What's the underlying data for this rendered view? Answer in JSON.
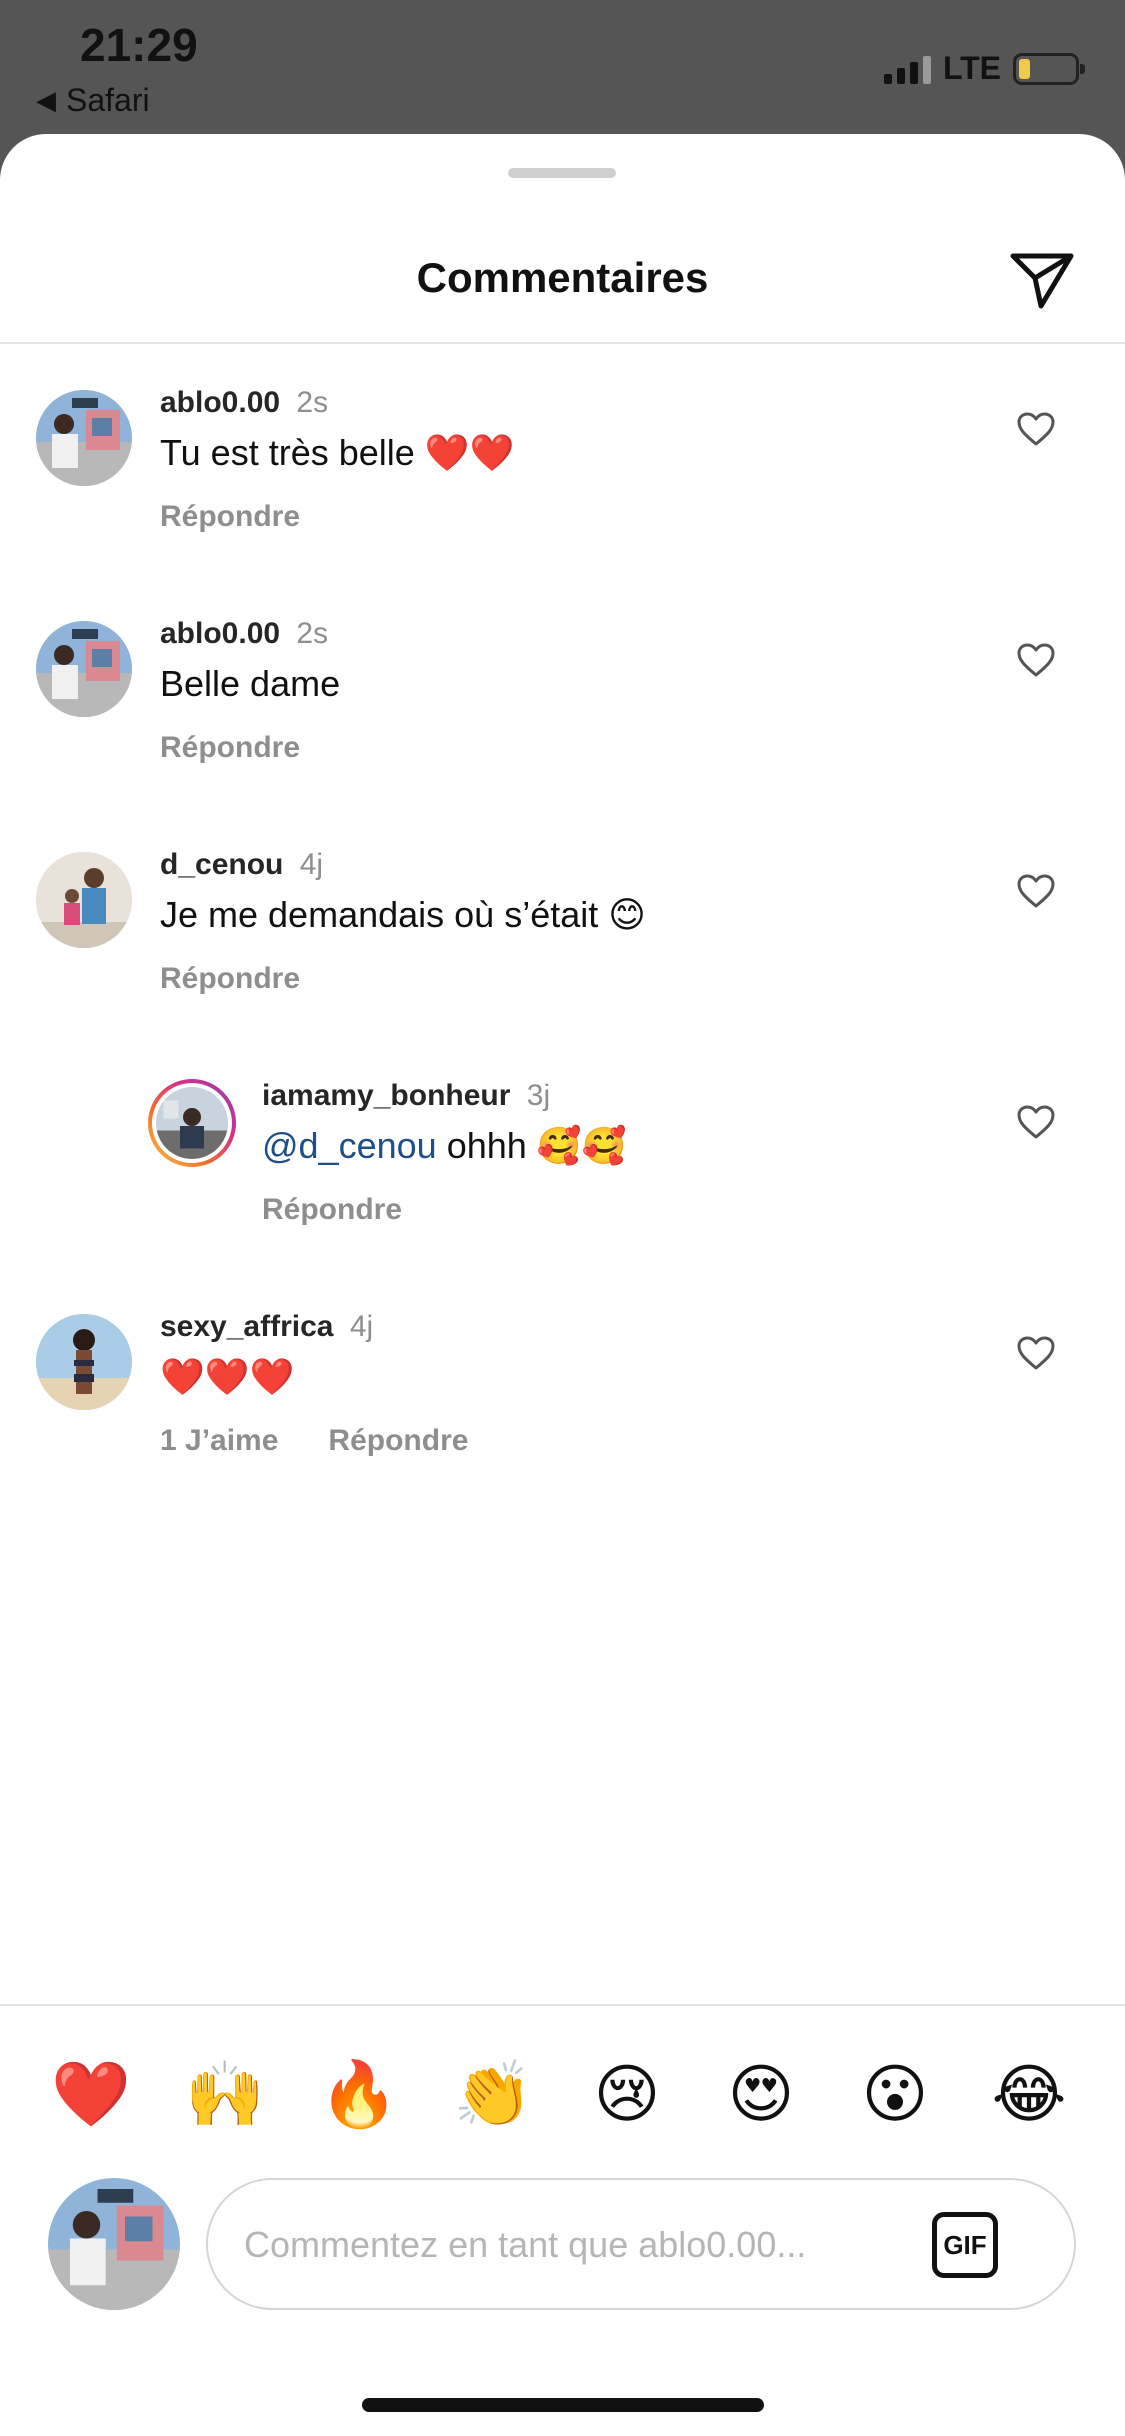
{
  "status_bar": {
    "time": "21:29",
    "back_app": "Safari",
    "back_arrow": "◀",
    "network": "LTE",
    "signal_bars_active": 3,
    "battery_level": 0.2,
    "battery_color": "#f2c94c"
  },
  "sheet": {
    "title": "Commentaires",
    "send_icon": "paper-plane-icon"
  },
  "comments": [
    {
      "username": "ablo0.00",
      "time": "2s",
      "text": "Tu est très belle ❤️❤️",
      "reply_label": "Répondre",
      "likes_label": "",
      "reply_to": ""
    },
    {
      "username": "ablo0.00",
      "time": "2s",
      "text": "Belle dame",
      "reply_label": "Répondre",
      "likes_label": "",
      "reply_to": ""
    },
    {
      "username": "d_cenou",
      "time": "4j",
      "text": "Je me demandais où s’était 😊",
      "reply_label": "Répondre",
      "likes_label": "",
      "reply_to": ""
    },
    {
      "username": "iamamy_bonheur",
      "time": "3j",
      "mention": "@d_cenou",
      "text": " ohhh 🥰🥰",
      "reply_label": "Répondre",
      "likes_label": "",
      "reply_to": "d_cenou"
    },
    {
      "username": "sexy_affrica",
      "time": "4j",
      "text": "❤️❤️❤️",
      "reply_label": "Répondre",
      "likes_label": "1 J’aime",
      "reply_to": ""
    }
  ],
  "reactions": [
    "❤️",
    "🙌",
    "🔥",
    "👏",
    "😢",
    "😍",
    "😮",
    "😂"
  ],
  "composer": {
    "placeholder": "Commentez en tant que ablo0.00...",
    "value": "",
    "gif_label": "GIF"
  },
  "colors": {
    "mention": "#1f4e89",
    "muted": "#8e8e8e",
    "story_ring": [
      "#f9c74f",
      "#f3722c",
      "#d62d8b",
      "#8e44ad"
    ]
  }
}
